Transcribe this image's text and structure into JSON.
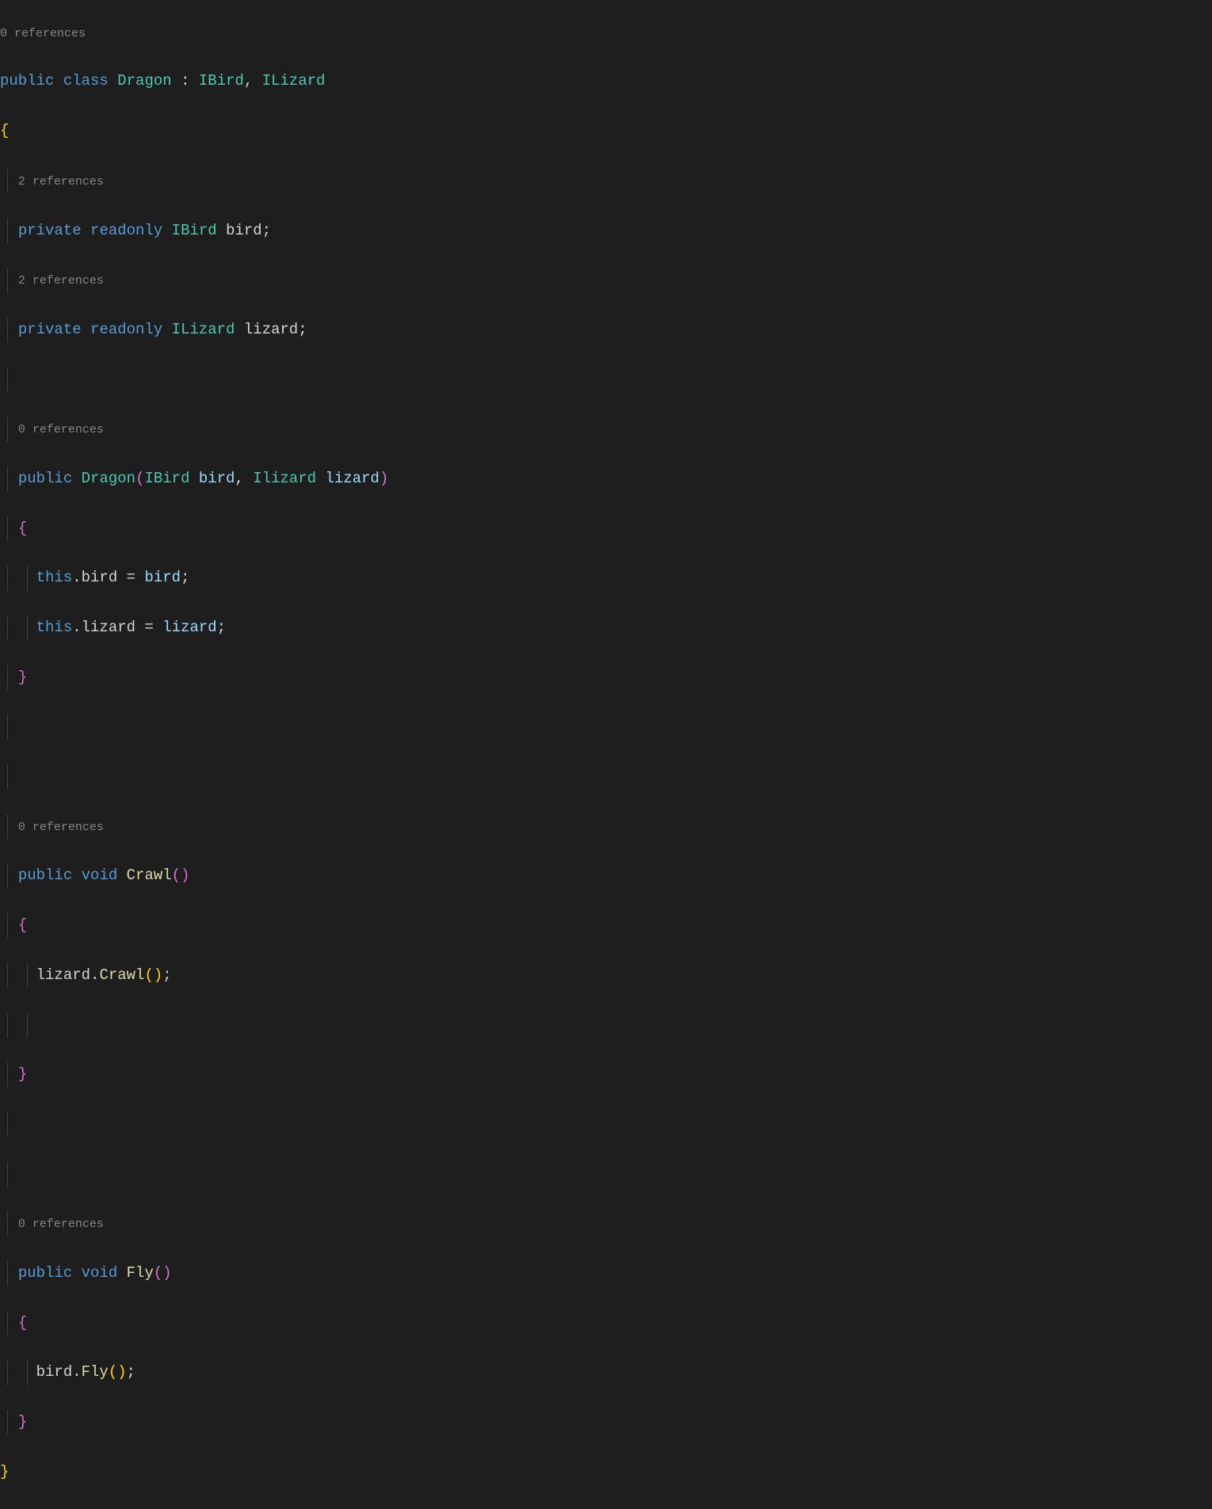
{
  "codelens": {
    "refs0": "0 references",
    "refs2": "2 references"
  },
  "t": {
    "public": "public",
    "class": "class",
    "private": "private",
    "readonly": "readonly",
    "void": "void",
    "this": "this",
    "Dragon": "Dragon",
    "IBird": "IBird",
    "ILizard": "ILizard",
    "Ilizard": "Ilizard",
    "bird": "bird",
    "lizard": "lizard",
    "Crawl": "Crawl",
    "Fly": "Fly",
    "colon": " : ",
    "comma": ", ",
    "semi": ";",
    "dot": ".",
    "eq": " = ",
    "obrace": "{",
    "cbrace": "}",
    "oparen": "(",
    "cparen": ")"
  }
}
